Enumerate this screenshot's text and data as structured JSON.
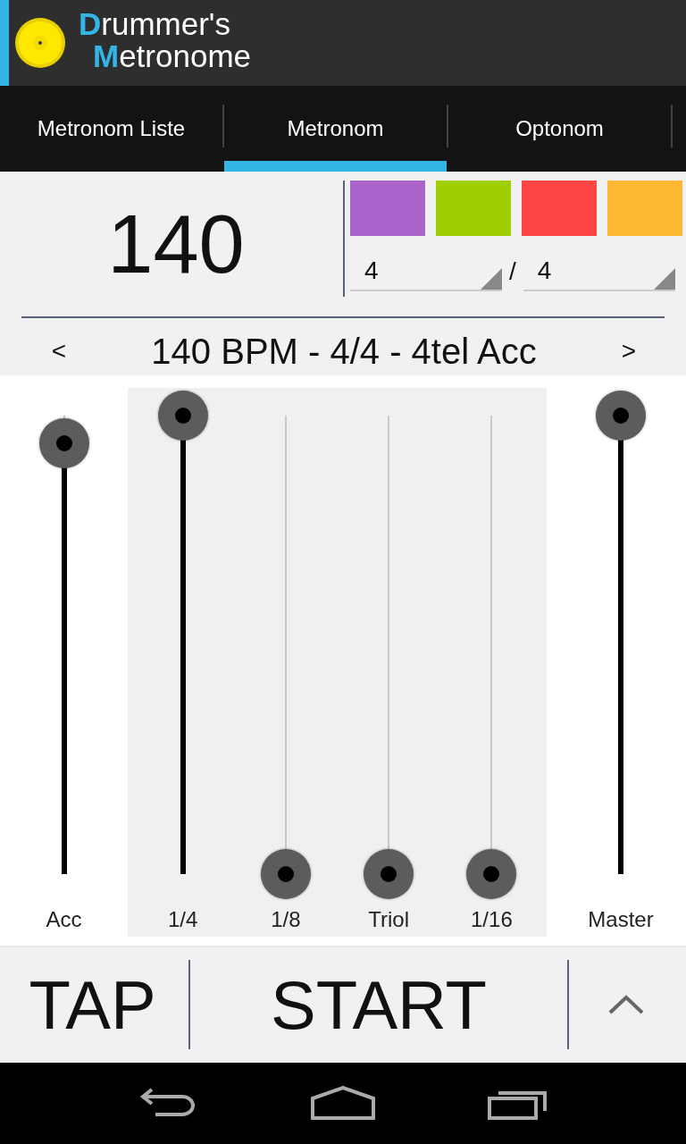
{
  "app_bar": {
    "title_lines": [
      "Drummer's",
      "Metronome"
    ]
  },
  "tabs": [
    {
      "label": "Metronom Liste",
      "selected": false
    },
    {
      "label": "Metronom",
      "selected": true
    },
    {
      "label": "Optonom",
      "selected": false
    }
  ],
  "tempo": {
    "bpm": "140",
    "beat_colors": [
      {
        "color": "#a964cc"
      },
      {
        "color": "#9fcf00"
      },
      {
        "color": "#ff4444"
      },
      {
        "color": "#ffb833"
      }
    ],
    "numerator": "4",
    "separator": "/",
    "denominator": "4"
  },
  "preset": {
    "prev": "<",
    "name": "140 BPM - 4/4 - 4tel Acc",
    "next": ">"
  },
  "accent_slider": {
    "label": "Acc",
    "level": 0.94
  },
  "note_sliders": [
    {
      "label": "1/4",
      "level": 1
    },
    {
      "label": "1/8",
      "level": 0
    },
    {
      "label": "Triol",
      "level": 0
    },
    {
      "label": "1/16",
      "level": 0
    }
  ],
  "master_slider": {
    "label": "Master",
    "level": 1
  },
  "bottom_bar": {
    "tap": "TAP",
    "start": "START"
  }
}
